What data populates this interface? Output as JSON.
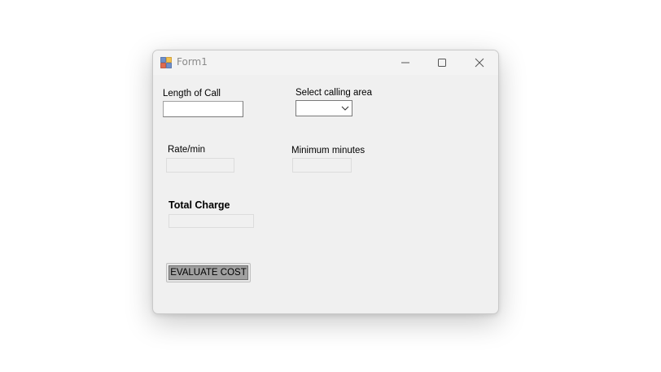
{
  "window": {
    "title": "Form1",
    "icons": {
      "app": "form-app-icon",
      "minimize": "minimize-icon",
      "maximize": "maximize-icon",
      "close": "close-icon"
    }
  },
  "form": {
    "length_of_call": {
      "label": "Length of Call",
      "value": ""
    },
    "calling_area": {
      "label": "Select calling area",
      "selected": "",
      "icon": "chevron-down-icon"
    },
    "rate_per_min": {
      "label": "Rate/min",
      "value": ""
    },
    "minimum_minutes": {
      "label": "Minimum minutes",
      "value": ""
    },
    "total_charge": {
      "label": "Total Charge",
      "value": ""
    },
    "evaluate_button": {
      "label": "EVALUATE COST"
    }
  }
}
